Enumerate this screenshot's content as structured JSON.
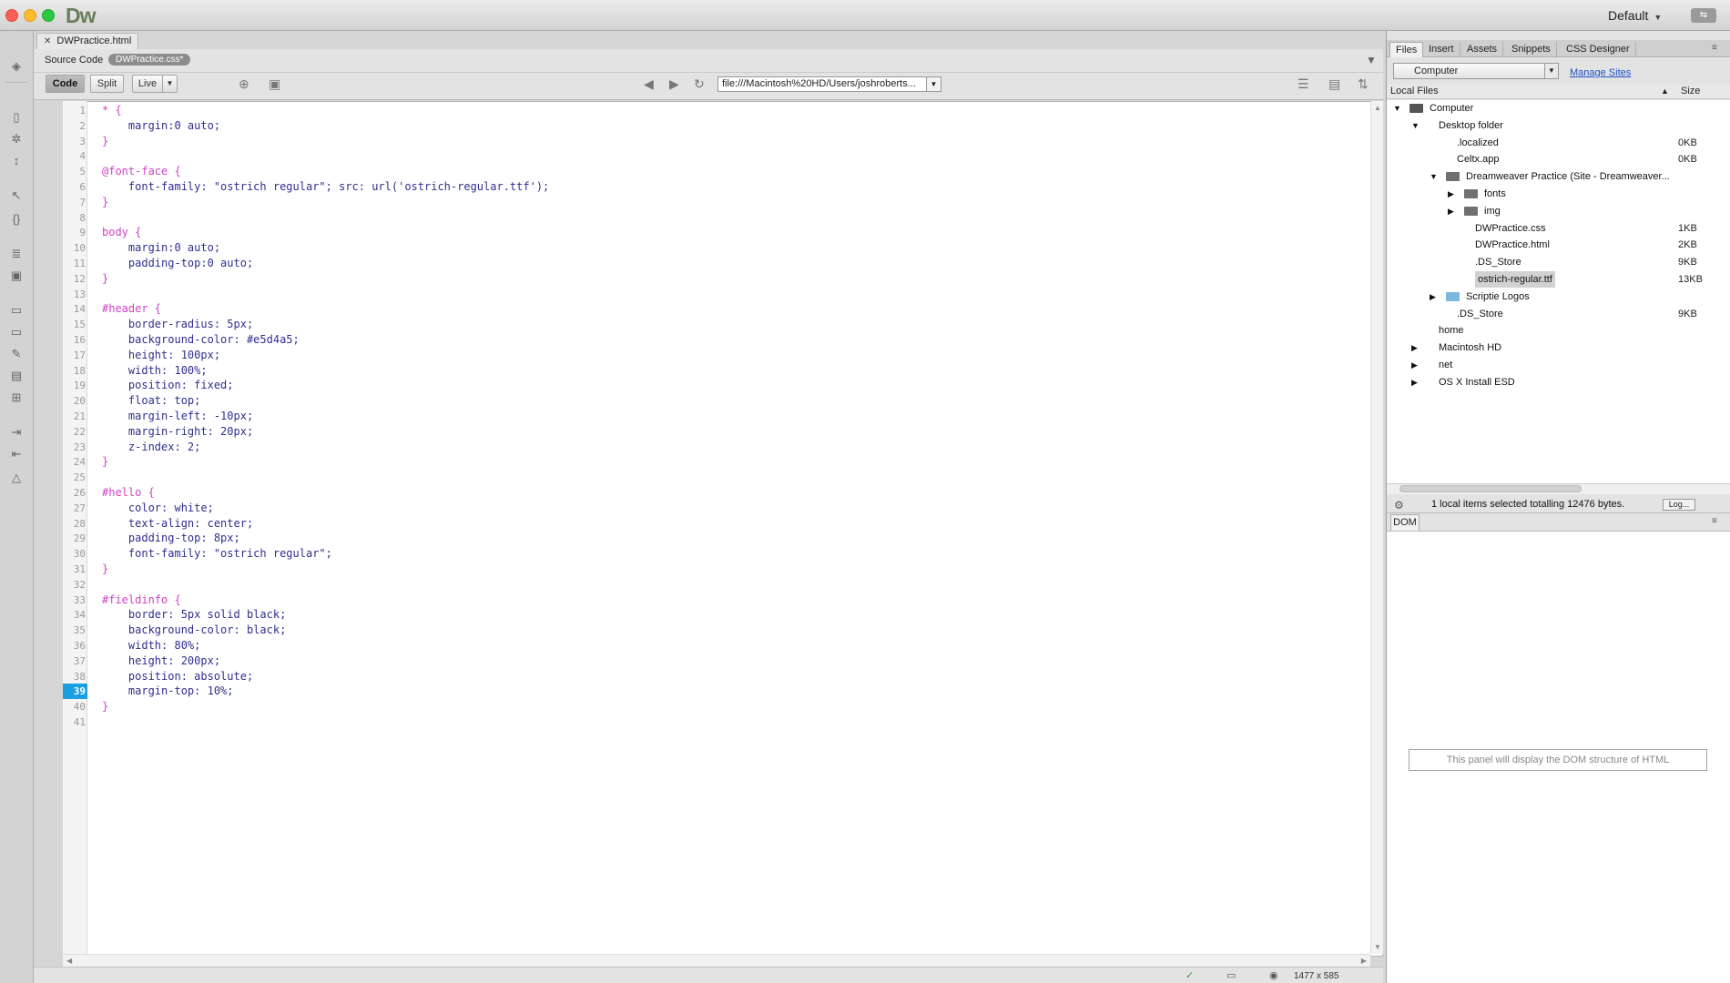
{
  "app": {
    "name": "Dw",
    "workspace": "Default"
  },
  "document": {
    "tab_title": "DWPractice.html",
    "related_label": "Source Code",
    "related_file": "DWPractice.css*",
    "view_buttons": {
      "code": "Code",
      "split": "Split",
      "live": "Live"
    },
    "url": "file:///Macintosh%20HD/Users/joshroberts..."
  },
  "code_lines": [
    {
      "n": "1",
      "text": "* {"
    },
    {
      "n": "2",
      "text": "    margin:0 auto;"
    },
    {
      "n": "3",
      "text": "}"
    },
    {
      "n": "4",
      "text": ""
    },
    {
      "n": "5",
      "text": "@font-face {"
    },
    {
      "n": "6",
      "text": "    font-family: \"ostrich regular\"; src: url('ostrich-regular.ttf');"
    },
    {
      "n": "7",
      "text": "}"
    },
    {
      "n": "8",
      "text": ""
    },
    {
      "n": "9",
      "text": "body {"
    },
    {
      "n": "10",
      "text": "    margin:0 auto;"
    },
    {
      "n": "11",
      "text": "    padding-top:0 auto;"
    },
    {
      "n": "12",
      "text": "}"
    },
    {
      "n": "13",
      "text": ""
    },
    {
      "n": "14",
      "text": "#header {"
    },
    {
      "n": "15",
      "text": "    border-radius: 5px;"
    },
    {
      "n": "16",
      "text": "    background-color: #e5d4a5;"
    },
    {
      "n": "17",
      "text": "    height: 100px;"
    },
    {
      "n": "18",
      "text": "    width: 100%;"
    },
    {
      "n": "19",
      "text": "    position: fixed;"
    },
    {
      "n": "20",
      "text": "    float: top;"
    },
    {
      "n": "21",
      "text": "    margin-left: -10px;"
    },
    {
      "n": "22",
      "text": "    margin-right: 20px;"
    },
    {
      "n": "23",
      "text": "    z-index: 2;"
    },
    {
      "n": "24",
      "text": "}"
    },
    {
      "n": "25",
      "text": ""
    },
    {
      "n": "26",
      "text": "#hello {"
    },
    {
      "n": "27",
      "text": "    color: white;"
    },
    {
      "n": "28",
      "text": "    text-align: center;"
    },
    {
      "n": "29",
      "text": "    padding-top: 8px;"
    },
    {
      "n": "30",
      "text": "    font-family: \"ostrich regular\";"
    },
    {
      "n": "31",
      "text": "}"
    },
    {
      "n": "32",
      "text": ""
    },
    {
      "n": "33",
      "text": "#fieldinfo {"
    },
    {
      "n": "34",
      "text": "    border: 5px solid black;"
    },
    {
      "n": "35",
      "text": "    background-color: black;"
    },
    {
      "n": "36",
      "text": "    width: 80%;"
    },
    {
      "n": "37",
      "text": "    height: 200px;"
    },
    {
      "n": "38",
      "text": "    position: absolute;"
    },
    {
      "n": "39",
      "text": "    margin-top: 10%;"
    },
    {
      "n": "40",
      "text": "}"
    },
    {
      "n": "41",
      "text": ""
    }
  ],
  "active_line": "39",
  "status": {
    "window_size": "1477 x 585"
  },
  "files_panel": {
    "tabs": [
      "Files",
      "Insert",
      "Assets",
      "Snippets",
      "CSS Designer"
    ],
    "site": "Computer",
    "manage_sites": "Manage Sites",
    "local_files_label": "Local Files",
    "size_label": "Size",
    "tree": [
      {
        "name": "Computer",
        "size": "",
        "toggle": "open",
        "icon": "computer-icon"
      },
      {
        "name": "Desktop folder",
        "size": "",
        "toggle": "open",
        "icon": ""
      },
      {
        "name": ".localized",
        "size": "0KB",
        "toggle": "",
        "icon": ""
      },
      {
        "name": "Celtx.app",
        "size": "0KB",
        "toggle": "",
        "icon": ""
      },
      {
        "name": "Dreamweaver Practice (Site - Dreamweaver...",
        "size": "",
        "toggle": "open",
        "icon": "folder-icon"
      },
      {
        "name": "fonts",
        "size": "",
        "toggle": "closed",
        "icon": "folder-icon"
      },
      {
        "name": "img",
        "size": "",
        "toggle": "closed",
        "icon": "folder-icon"
      },
      {
        "name": "DWPractice.css",
        "size": "1KB",
        "toggle": "",
        "icon": ""
      },
      {
        "name": "DWPractice.html",
        "size": "2KB",
        "toggle": "",
        "icon": ""
      },
      {
        "name": ".DS_Store",
        "size": "9KB",
        "toggle": "",
        "icon": ""
      },
      {
        "name": "ostrich-regular.ttf",
        "size": "13KB",
        "toggle": "",
        "icon": ""
      },
      {
        "name": "Scriptie Logos",
        "size": "",
        "toggle": "closed",
        "icon": "folder-blue-icon"
      },
      {
        "name": ".DS_Store",
        "size": "9KB",
        "toggle": "",
        "icon": ""
      },
      {
        "name": "home",
        "size": "",
        "toggle": "",
        "icon": ""
      },
      {
        "name": "Macintosh HD",
        "size": "",
        "toggle": "closed",
        "icon": ""
      },
      {
        "name": "net",
        "size": "",
        "toggle": "closed",
        "icon": ""
      },
      {
        "name": "OS X Install ESD",
        "size": "",
        "toggle": "closed",
        "icon": ""
      }
    ],
    "selected_item": "ostrich-regular.ttf",
    "status_text": "1 local items selected totalling 12476 bytes.",
    "log_button": "Log..."
  },
  "dom_panel": {
    "tab": "DOM",
    "placeholder": "This panel will display the DOM structure of HTML"
  },
  "colors": {
    "selector": "#d041c9",
    "property": "#2f2f8f",
    "string": "#2e7d1b",
    "active_line": "#1a9fe0"
  }
}
